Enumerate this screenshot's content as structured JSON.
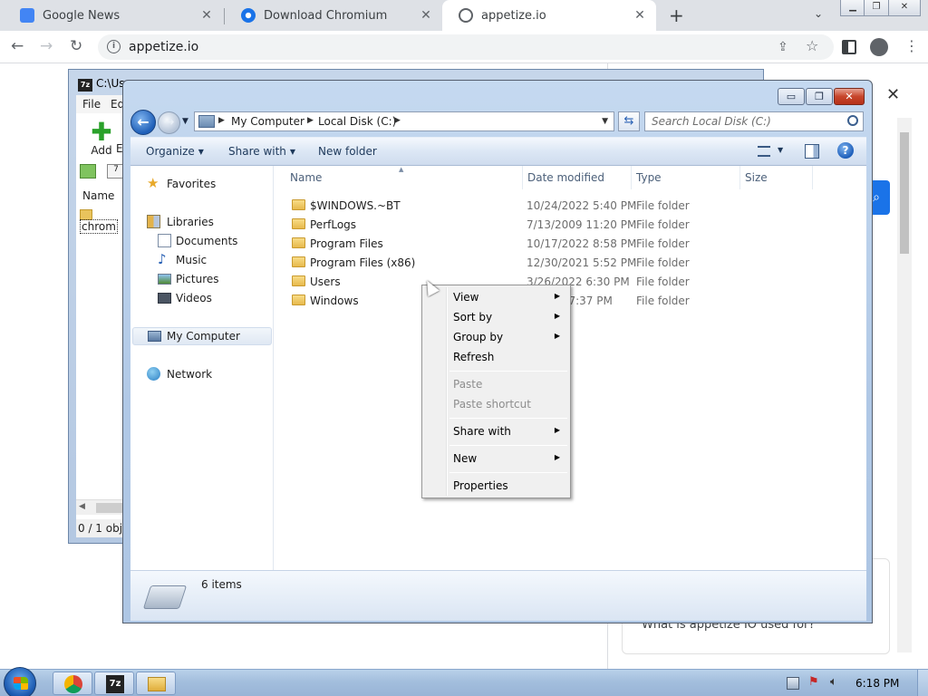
{
  "browser": {
    "tabs": [
      {
        "title": "Google News",
        "active": false,
        "favicon_color": "#4285f4"
      },
      {
        "title": "Download Chromium",
        "active": false,
        "favicon_color": "#1a73e8"
      },
      {
        "title": "appetize.io",
        "active": true,
        "favicon_color": "#5f6368"
      }
    ],
    "new_tab_symbol": "+",
    "url": "appetize.io"
  },
  "page": {
    "close_symbol": "✕",
    "question": "What is appetize IO used for?"
  },
  "sevenzip": {
    "title": "C:\\Us",
    "logo": "7z",
    "menu": [
      "File",
      "Ed"
    ],
    "add_label": "Add",
    "e_label": "E",
    "column_name": "Name",
    "item": "chrom",
    "status": "0 / 1 obje"
  },
  "explorer": {
    "captions": {
      "minimize": "▭",
      "maximize": "❐",
      "close": "✕"
    },
    "breadcrumbs": [
      "My Computer",
      "Local Disk (C:)"
    ],
    "search_placeholder": "Search Local Disk (C:)",
    "commands": {
      "organize": "Organize",
      "share_with": "Share with",
      "new_folder": "New folder"
    },
    "help_symbol": "?",
    "nav": {
      "favorites": "Favorites",
      "libraries": "Libraries",
      "documents": "Documents",
      "music": "Music",
      "pictures": "Pictures",
      "videos": "Videos",
      "my_computer": "My Computer",
      "network": "Network"
    },
    "columns": {
      "name": "Name",
      "date": "Date modified",
      "type": "Type",
      "size": "Size"
    },
    "files": [
      {
        "name": "$WINDOWS.~BT",
        "date": "10/24/2022 5:40 PM",
        "type": "File folder"
      },
      {
        "name": "PerfLogs",
        "date": "7/13/2009 11:20 PM",
        "type": "File folder"
      },
      {
        "name": "Program Files",
        "date": "10/17/2022 8:58 PM",
        "type": "File folder"
      },
      {
        "name": "Program Files (x86)",
        "date": "12/30/2021 5:52 PM",
        "type": "File folder"
      },
      {
        "name": "Users",
        "date": "3/26/2022 6:30 PM",
        "type": "File folder"
      },
      {
        "name": "Windows",
        "date": "2 7:37 PM",
        "type": "File folder"
      }
    ],
    "item_count": "6 items"
  },
  "context_menu": {
    "view": "View",
    "sort_by": "Sort by",
    "group_by": "Group by",
    "refresh": "Refresh",
    "paste": "Paste",
    "paste_shortcut": "Paste shortcut",
    "share_with": "Share with",
    "new": "New",
    "properties": "Properties"
  },
  "taskbar": {
    "sevenzip_label": "7z",
    "clock": "6:18 PM"
  }
}
